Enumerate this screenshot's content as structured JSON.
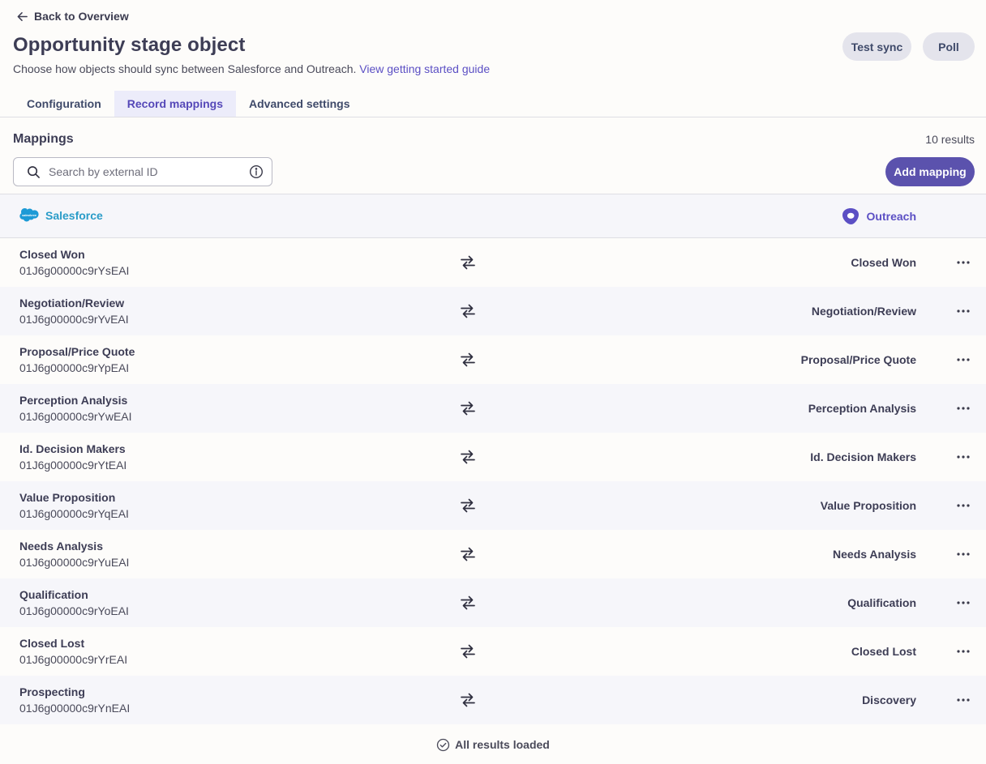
{
  "header": {
    "back_label": "Back to Overview",
    "title": "Opportunity stage object",
    "subtitle": "Choose how objects should sync between Salesforce and Outreach.",
    "guide_link": "View getting started guide",
    "test_sync_label": "Test sync",
    "poll_label": "Poll"
  },
  "tabs": [
    {
      "label": "Configuration",
      "active": false
    },
    {
      "label": "Record mappings",
      "active": true
    },
    {
      "label": "Advanced settings",
      "active": false
    }
  ],
  "mappings": {
    "title": "Mappings",
    "results_count": "10 results",
    "search_placeholder": "Search by external ID",
    "add_label": "Add mapping"
  },
  "columns": {
    "left": "Salesforce",
    "right": "Outreach",
    "salesforce_logo_text": "salesforce"
  },
  "rows": [
    {
      "name": "Closed Won",
      "id": "01J6g00000c9rYsEAI",
      "target": "Closed Won"
    },
    {
      "name": "Negotiation/Review",
      "id": "01J6g00000c9rYvEAI",
      "target": "Negotiation/Review"
    },
    {
      "name": "Proposal/Price Quote",
      "id": "01J6g00000c9rYpEAI",
      "target": "Proposal/Price Quote"
    },
    {
      "name": "Perception Analysis",
      "id": "01J6g00000c9rYwEAI",
      "target": "Perception Analysis"
    },
    {
      "name": "Id. Decision Makers",
      "id": "01J6g00000c9rYtEAI",
      "target": "Id. Decision Makers"
    },
    {
      "name": "Value Proposition",
      "id": "01J6g00000c9rYqEAI",
      "target": "Value Proposition"
    },
    {
      "name": "Needs Analysis",
      "id": "01J6g00000c9rYuEAI",
      "target": "Needs Analysis"
    },
    {
      "name": "Qualification",
      "id": "01J6g00000c9rYoEAI",
      "target": "Qualification"
    },
    {
      "name": "Closed Lost",
      "id": "01J6g00000c9rYrEAI",
      "target": "Closed Lost"
    },
    {
      "name": "Prospecting",
      "id": "01J6g00000c9rYnEAI",
      "target": "Discovery"
    }
  ],
  "footer": {
    "status": "All results loaded"
  },
  "icons": {
    "back": "arrow-left-icon",
    "search": "search-icon",
    "info": "info-icon",
    "sync": "bidirectional-sync-icon",
    "more": "more-horizontal-icon",
    "done": "check-circle-icon"
  },
  "colors": {
    "accent": "#5b52ad",
    "link": "#5b4fc4",
    "salesforce": "#2a9cc8",
    "outreach": "#5b4fc4"
  }
}
